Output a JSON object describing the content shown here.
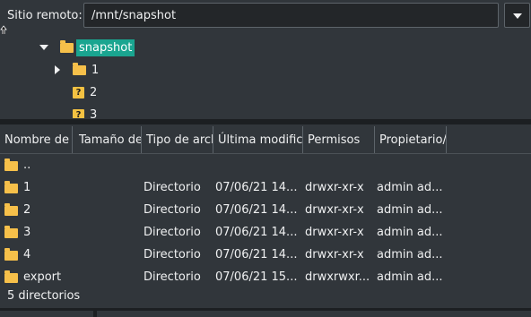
{
  "remote": {
    "label": "Sitio remoto:",
    "path": "/mnt/snapshot"
  },
  "tree": {
    "root": "snapshot",
    "children": [
      "1",
      "2",
      "3"
    ]
  },
  "columns": [
    "Nombre de",
    "Tamaño de",
    "Tipo de arch",
    "Última modifica",
    "Permisos",
    "Propietario/"
  ],
  "files": [
    {
      "name": "..",
      "type": "",
      "modified": "",
      "perms": "",
      "owner": ""
    },
    {
      "name": "1",
      "type": "Directorio",
      "modified": "07/06/21 14...",
      "perms": "drwxr-xr-x",
      "owner": "admin ad..."
    },
    {
      "name": "2",
      "type": "Directorio",
      "modified": "07/06/21 14...",
      "perms": "drwxr-xr-x",
      "owner": "admin ad..."
    },
    {
      "name": "3",
      "type": "Directorio",
      "modified": "07/06/21 14...",
      "perms": "drwxr-xr-x",
      "owner": "admin ad..."
    },
    {
      "name": "4",
      "type": "Directorio",
      "modified": "07/06/21 14...",
      "perms": "drwxr-xr-x",
      "owner": "admin ad..."
    },
    {
      "name": "export",
      "type": "Directorio",
      "modified": "07/06/21 15...",
      "perms": "drwxrwxr...",
      "owner": "admin ad..."
    }
  ],
  "status": "5 directorios",
  "colors": {
    "background": "#31363b",
    "selection": "#1aa590",
    "folder": "#f6c04a"
  }
}
